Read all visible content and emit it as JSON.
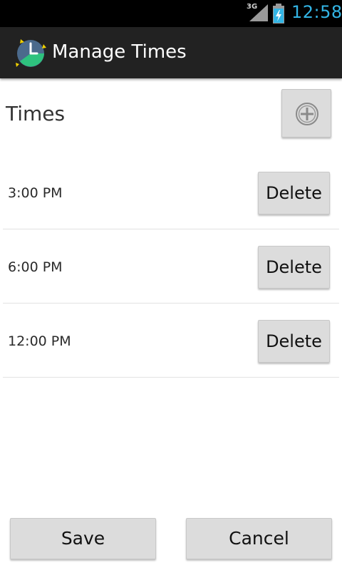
{
  "status_bar": {
    "network_type": "3G",
    "time": "12:58",
    "icons": [
      "signal-icon",
      "battery-charging-icon"
    ],
    "clock_color": "#33b5e5"
  },
  "action_bar": {
    "title": "Manage Times",
    "icon": "clock-pie-app-icon"
  },
  "header": {
    "title": "Times",
    "add_icon": "plus-circle-icon"
  },
  "times": [
    {
      "time": "3:00 PM",
      "delete_label": "Delete"
    },
    {
      "time": "6:00 PM",
      "delete_label": "Delete"
    },
    {
      "time": "12:00 PM",
      "delete_label": "Delete"
    }
  ],
  "footer": {
    "save_label": "Save",
    "cancel_label": "Cancel"
  }
}
